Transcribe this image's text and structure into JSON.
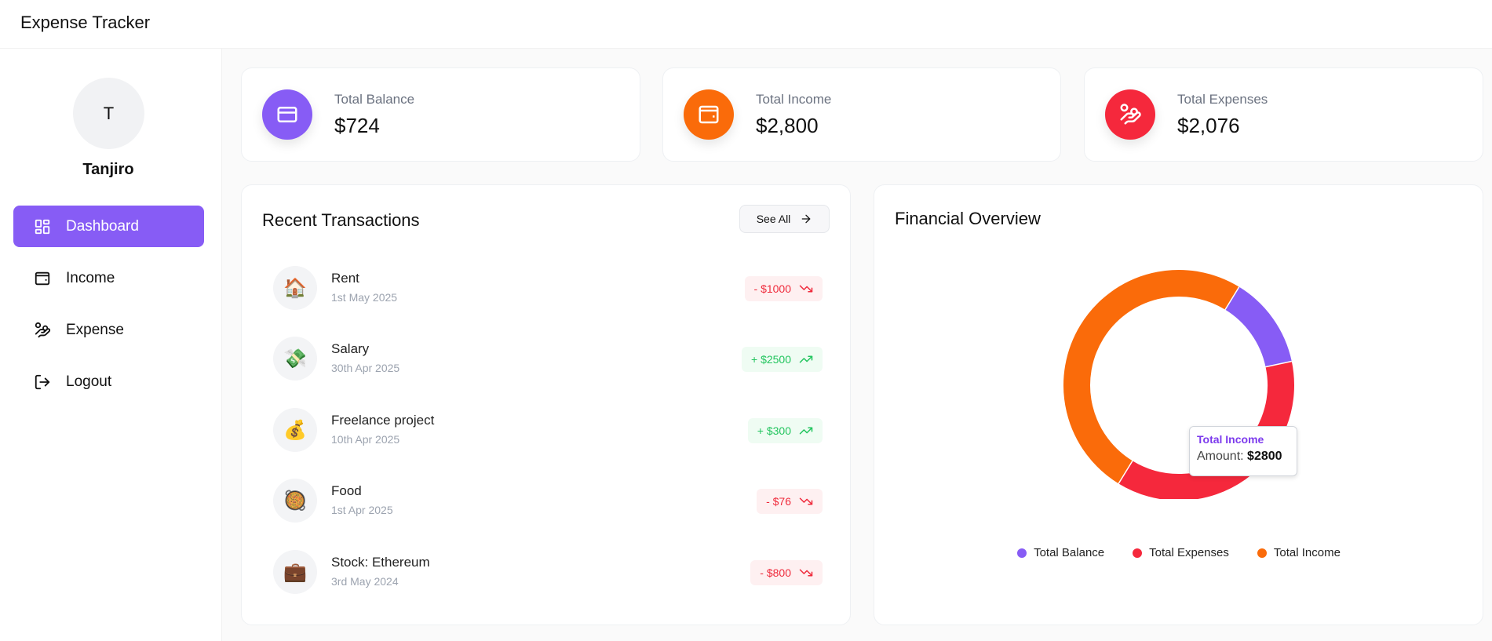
{
  "app": {
    "title": "Expense Tracker"
  },
  "user": {
    "initial": "T",
    "name": "Tanjiro"
  },
  "nav": [
    {
      "label": "Dashboard",
      "icon": "dashboard-icon",
      "active": true
    },
    {
      "label": "Income",
      "icon": "wallet-icon",
      "active": false
    },
    {
      "label": "Expense",
      "icon": "hand-coins-icon",
      "active": false
    },
    {
      "label": "Logout",
      "icon": "logout-icon",
      "active": false
    }
  ],
  "stats": [
    {
      "label": "Total Balance",
      "value": "$724",
      "color": "#875cf5",
      "icon": "credit-card-icon"
    },
    {
      "label": "Total Income",
      "value": "$2,800",
      "color": "#fa6b0a",
      "icon": "wallet-icon"
    },
    {
      "label": "Total Expenses",
      "value": "$2,076",
      "color": "#f5283c",
      "icon": "hand-coins-icon"
    }
  ],
  "recent": {
    "title": "Recent Transactions",
    "see_all": "See All",
    "items": [
      {
        "icon": "🏠",
        "title": "Rent",
        "date": "1st May 2025",
        "amount": "- $1000",
        "type": "expense"
      },
      {
        "icon": "💸",
        "title": "Salary",
        "date": "30th Apr 2025",
        "amount": "+ $2500",
        "type": "income"
      },
      {
        "icon": "💰",
        "title": "Freelance project",
        "date": "10th Apr 2025",
        "amount": "+ $300",
        "type": "income"
      },
      {
        "icon": "🥘",
        "title": "Food",
        "date": "1st Apr 2025",
        "amount": "- $76",
        "type": "expense"
      },
      {
        "icon": "💼",
        "title": "Stock: Ethereum",
        "date": "3rd May 2024",
        "amount": "- $800",
        "type": "expense"
      }
    ]
  },
  "overview": {
    "title": "Financial Overview",
    "tooltip": {
      "title": "Total Income",
      "label": "Amount:",
      "value": "$2800"
    }
  },
  "chart_data": {
    "type": "pie",
    "variant": "donut",
    "categories": [
      "Total Balance",
      "Total Expenses",
      "Total Income"
    ],
    "values": [
      724,
      2076,
      2800
    ],
    "colors": [
      "#875cf5",
      "#f5283c",
      "#fa6b0a"
    ],
    "legend_position": "bottom"
  }
}
